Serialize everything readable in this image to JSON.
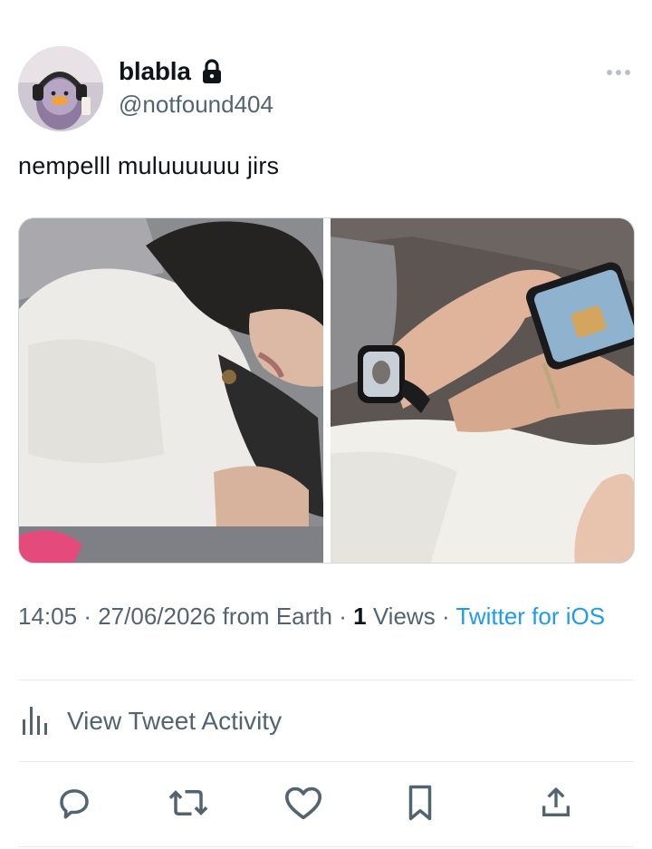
{
  "user": {
    "display_name": "blabla",
    "handle": "@notfound404",
    "verified_lock": "lock-icon",
    "avatar_icon": "duck-headphones-avatar"
  },
  "tweet": {
    "text": "nempelll muluuuuuu jirs"
  },
  "media": {
    "images": [
      {
        "description_icon": "photo-person-lying-icon"
      },
      {
        "description_icon": "photo-watch-phone-icon"
      }
    ]
  },
  "meta": {
    "time": "14:05",
    "separator": "·",
    "date": "27/06/2026",
    "location": "from Earth",
    "views_count": "1",
    "views_label": "Views",
    "source": "Twitter for iOS"
  },
  "activity": {
    "label": "View Tweet Activity",
    "icon": "bar-chart-icon"
  },
  "actions": {
    "reply": "reply-icon",
    "retweet": "retweet-icon",
    "like": "heart-icon",
    "bookmark": "bookmark-icon",
    "share": "share-icon"
  },
  "colors": {
    "text": "#0f1419",
    "secondary": "#536471",
    "link": "#1d9bf0",
    "divider": "#e6ebee"
  }
}
